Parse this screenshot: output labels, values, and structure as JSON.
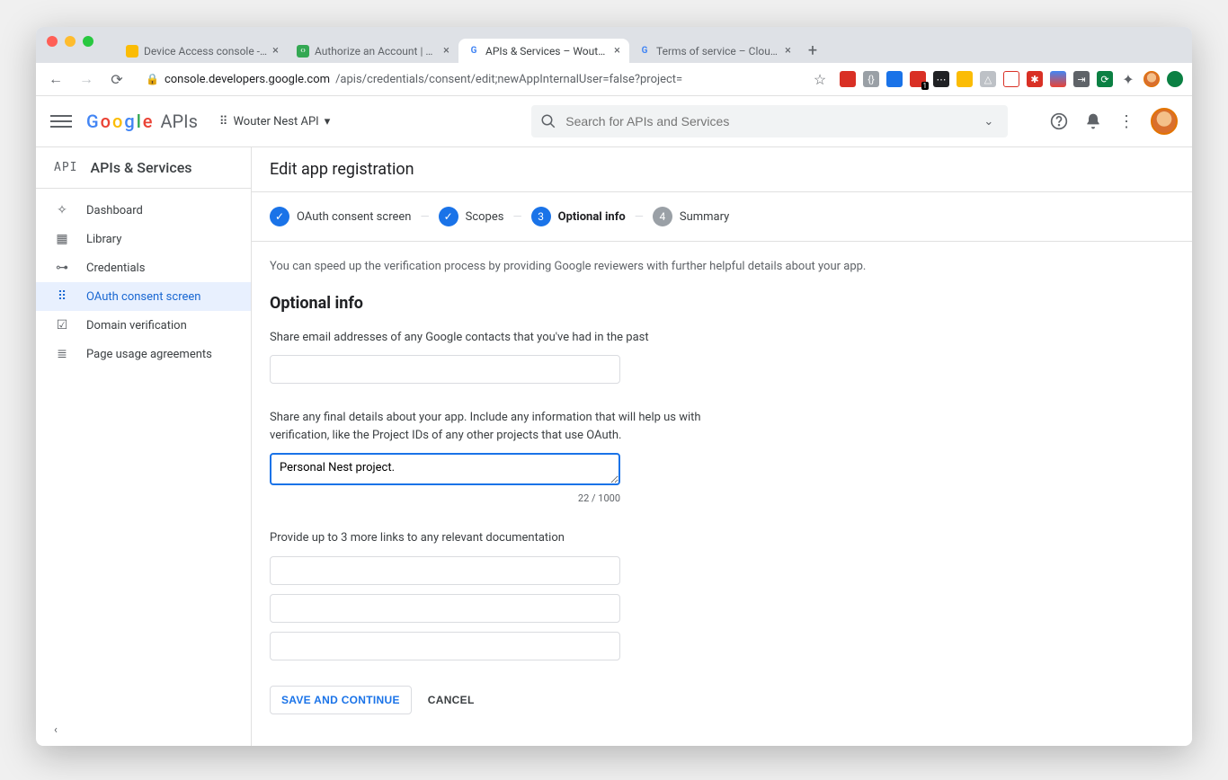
{
  "browser": {
    "tabs": [
      {
        "title": "Device Access console - Proje",
        "favColor": "#fbbc05"
      },
      {
        "title": "Authorize an Account | Devic",
        "favColor": "#34a853"
      },
      {
        "title": "APIs & Services – Wouter Nest",
        "favColor": "#4285F4"
      },
      {
        "title": "Terms of service – Cloud Funct",
        "favColor": "#4285F4"
      }
    ],
    "activeTab": 2,
    "urlHost": "console.developers.google.com",
    "urlPath": "/apis/credentials/consent/edit;newAppInternalUser=false?project="
  },
  "header": {
    "project": "Wouter Nest API",
    "searchPlaceholder": "Search for APIs and Services"
  },
  "sidebar": {
    "title": "APIs & Services",
    "items": [
      {
        "icon": "⊞",
        "label": "Dashboard"
      },
      {
        "icon": "▥",
        "label": "Library"
      },
      {
        "icon": "⊸",
        "label": "Credentials"
      },
      {
        "icon": "⠿",
        "label": "OAuth consent screen"
      },
      {
        "icon": "☑",
        "label": "Domain verification"
      },
      {
        "icon": "≣",
        "label": "Page usage agreements"
      }
    ],
    "selected": 3
  },
  "page": {
    "title": "Edit app registration",
    "steps": [
      {
        "label": "OAuth consent screen",
        "state": "done"
      },
      {
        "label": "Scopes",
        "state": "done"
      },
      {
        "label": "Optional info",
        "state": "cur",
        "num": "3"
      },
      {
        "label": "Summary",
        "state": "todo",
        "num": "4"
      }
    ],
    "helpText": "You can speed up the verification process by providing Google reviewers with further helpful details about your app.",
    "sectionTitle": "Optional info",
    "field1Label": "Share email addresses of any Google contacts that you've had in the past",
    "field1Value": "",
    "field2Label": "Share any final details about your app. Include any information that will help us with verification, like the Project IDs of any other projects that use OAuth.",
    "field2Value": "Personal Nest project.",
    "field2Counter": "22 / 1000",
    "field3Label": "Provide up to 3 more links to any relevant documentation",
    "saveLabel": "SAVE AND CONTINUE",
    "cancelLabel": "CANCEL"
  }
}
